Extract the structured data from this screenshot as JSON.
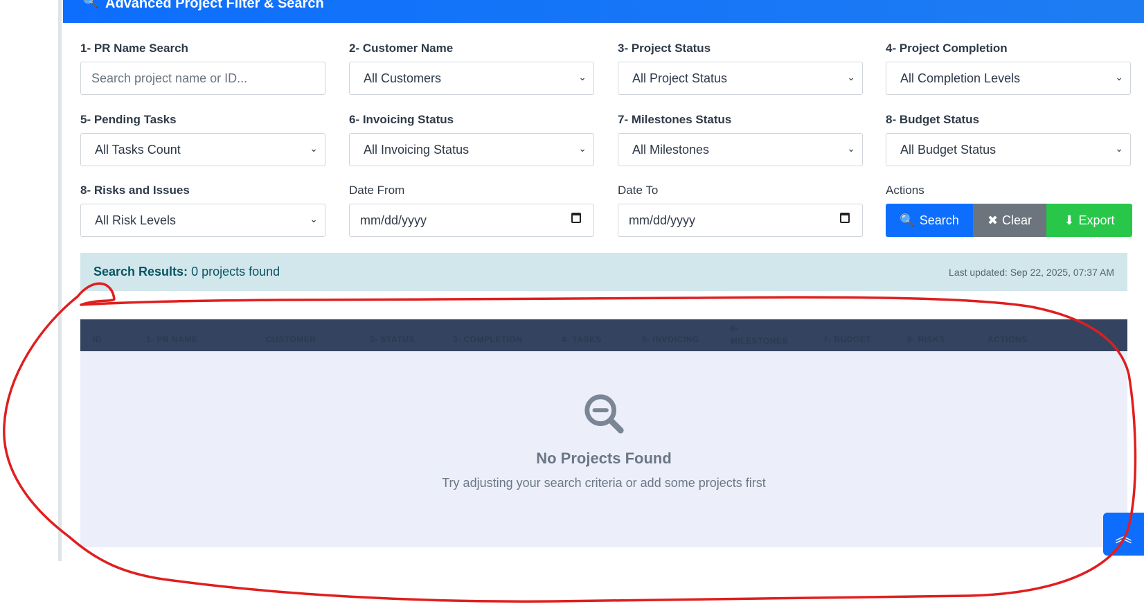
{
  "header": {
    "title": "Advanced Project Filter & Search",
    "icon": "search-icon"
  },
  "filters": {
    "pr_name": {
      "label": "1- PR Name Search",
      "placeholder": "Search project name or ID..."
    },
    "customer": {
      "label": "2- Customer Name",
      "value": "All Customers"
    },
    "project_status": {
      "label": "3- Project Status",
      "value": "All Project Status"
    },
    "completion": {
      "label": "4- Project Completion",
      "value": "All Completion Levels"
    },
    "pending_tasks": {
      "label": "5- Pending Tasks",
      "value": "All Tasks Count"
    },
    "invoicing": {
      "label": "6- Invoicing Status",
      "value": "All Invoicing Status"
    },
    "milestones": {
      "label": "7- Milestones Status",
      "value": "All Milestones"
    },
    "budget": {
      "label": "8- Budget Status",
      "value": "All Budget Status"
    },
    "risks": {
      "label": "8- Risks and Issues",
      "value": "All Risk Levels"
    },
    "date_from": {
      "label": "Date From",
      "placeholder": "mm/dd/yyyy"
    },
    "date_to": {
      "label": "Date To",
      "placeholder": "mm/dd/yyyy"
    }
  },
  "actions": {
    "label": "Actions",
    "search": "Search",
    "clear": "Clear",
    "export": "Export"
  },
  "results": {
    "prefix": "Search Results:",
    "count_text": "0 projects found",
    "last_updated": "Last updated: Sep 22, 2025, 07:37 AM"
  },
  "table": {
    "columns": [
      "ID",
      "1- PR NAME",
      "CUSTOMER",
      "2- STATUS",
      "3- COMPLETION",
      "4- TASKS",
      "5- INVOICING",
      "6- MILESTONES",
      "7- BUDGET",
      "8- RISKS",
      "ACTIONS"
    ]
  },
  "empty_state": {
    "icon": "search-minus-icon",
    "title": "No Projects Found",
    "subtitle": "Try adjusting your search criteria or add some projects first"
  },
  "scroll_top": {
    "icon": "double-chevron-up-icon"
  },
  "colors": {
    "primary": "#0d6efd",
    "secondary": "#6c757d",
    "success": "#28c74a",
    "annotation": "#e01e1e"
  }
}
